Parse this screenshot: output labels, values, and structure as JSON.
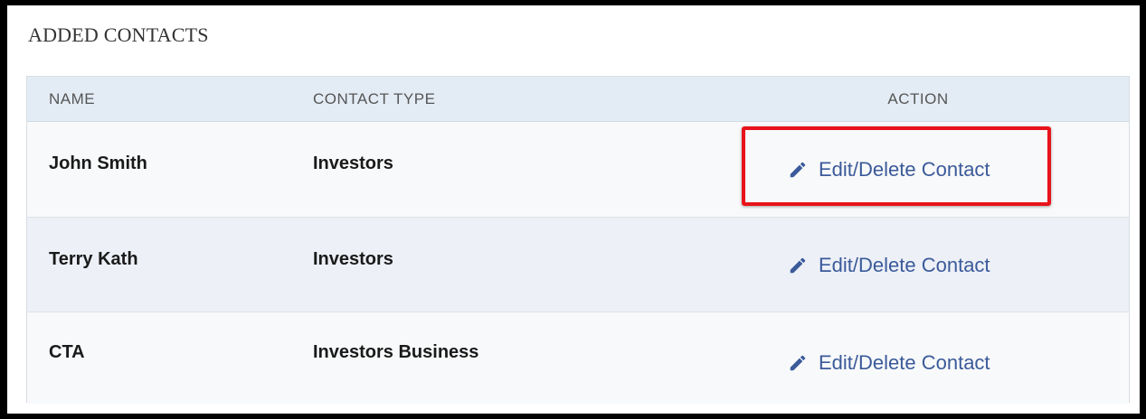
{
  "section": {
    "title": "ADDED CONTACTS"
  },
  "table": {
    "headers": {
      "name": "NAME",
      "contact_type": "CONTACT TYPE",
      "action": "ACTION"
    },
    "rows": [
      {
        "name": "John Smith",
        "contact_type": "Investors",
        "action_label": "Edit/Delete Contact"
      },
      {
        "name": "Terry Kath",
        "contact_type": "Investors",
        "action_label": "Edit/Delete Contact"
      },
      {
        "name": "CTA",
        "contact_type": "Investors Business",
        "action_label": "Edit/Delete Contact"
      }
    ]
  },
  "icons": {
    "action": "pencil-icon"
  },
  "colors": {
    "link": "#3b5a9a",
    "highlight": "#e8131a",
    "header_bg": "#e3ecf5"
  }
}
